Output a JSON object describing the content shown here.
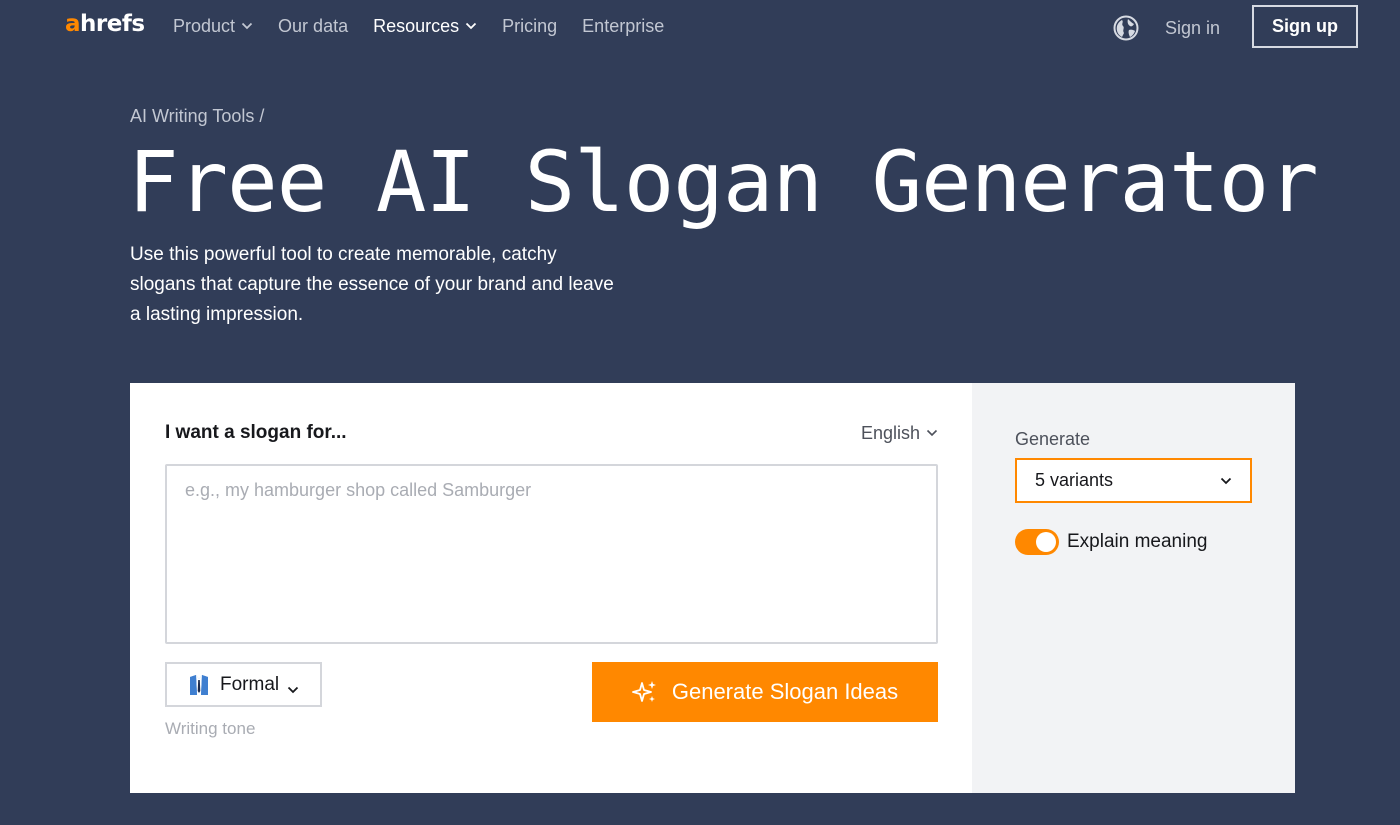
{
  "nav": {
    "logo_a": "a",
    "logo_rest": "hrefs",
    "items": [
      {
        "label": "Product",
        "dropdown": true,
        "active": false
      },
      {
        "label": "Our data",
        "dropdown": false,
        "active": false
      },
      {
        "label": "Resources",
        "dropdown": true,
        "active": true
      },
      {
        "label": "Pricing",
        "dropdown": false,
        "active": false
      },
      {
        "label": "Enterprise",
        "dropdown": false,
        "active": false
      }
    ],
    "globe_icon": "globe-icon",
    "sign_in": "Sign in",
    "sign_up": "Sign up"
  },
  "hero": {
    "breadcrumb": "AI Writing Tools /",
    "title": "Free AI Slogan Generator",
    "subtitle": "Use this powerful tool to create memorable, catchy slogans that capture the essence of your brand and leave a lasting impression."
  },
  "tool": {
    "prompt_label": "I want a slogan for...",
    "language": "English",
    "prompt_placeholder": "e.g., my hamburger shop called Samburger",
    "prompt_value": "",
    "tone": "Formal",
    "tone_icon": "suit-icon",
    "tone_help": "Writing tone",
    "generate_button": "Generate Slogan Ideas",
    "generate_icon": "sparkle-icon",
    "side": {
      "generate_label": "Generate",
      "variants": "5 variants",
      "explain_label": "Explain meaning",
      "explain_on": true
    }
  },
  "colors": {
    "background": "#313d58",
    "accent": "#ff8800",
    "card": "#ffffff",
    "side_panel": "#f2f3f5"
  }
}
